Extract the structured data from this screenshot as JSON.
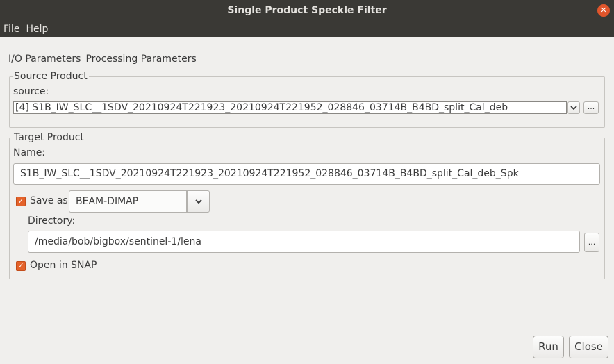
{
  "window": {
    "title": "Single Product Speckle Filter",
    "close_glyph": "✕"
  },
  "menu": {
    "file": "File",
    "help": "Help"
  },
  "tabs": [
    "I/O Parameters",
    "Processing Parameters"
  ],
  "source_product": {
    "legend": "Source Product",
    "label": "source:",
    "value": "[4] S1B_IW_SLC__1SDV_20210924T221923_20210924T221952_028846_03714B_B4BD_split_Cal_deb",
    "browse_label": "..."
  },
  "target_product": {
    "legend": "Target Product",
    "name_label": "Name:",
    "name_value": "S1B_IW_SLC__1SDV_20210924T221923_20210924T221952_028846_03714B_B4BD_split_Cal_deb_Spk",
    "save_as_label": "Save as:",
    "save_as_checked": true,
    "format_value": "BEAM-DIMAP",
    "directory_label": "Directory:",
    "directory_value": "/media/bob/bigbox/sentinel-1/lena",
    "browse_label": "...",
    "open_in_snap_label": "Open in SNAP",
    "open_in_snap_checked": true
  },
  "buttons": {
    "run": "Run",
    "close": "Close"
  },
  "colors": {
    "accent": "#e4622a",
    "titlebar": "#3a3935"
  }
}
